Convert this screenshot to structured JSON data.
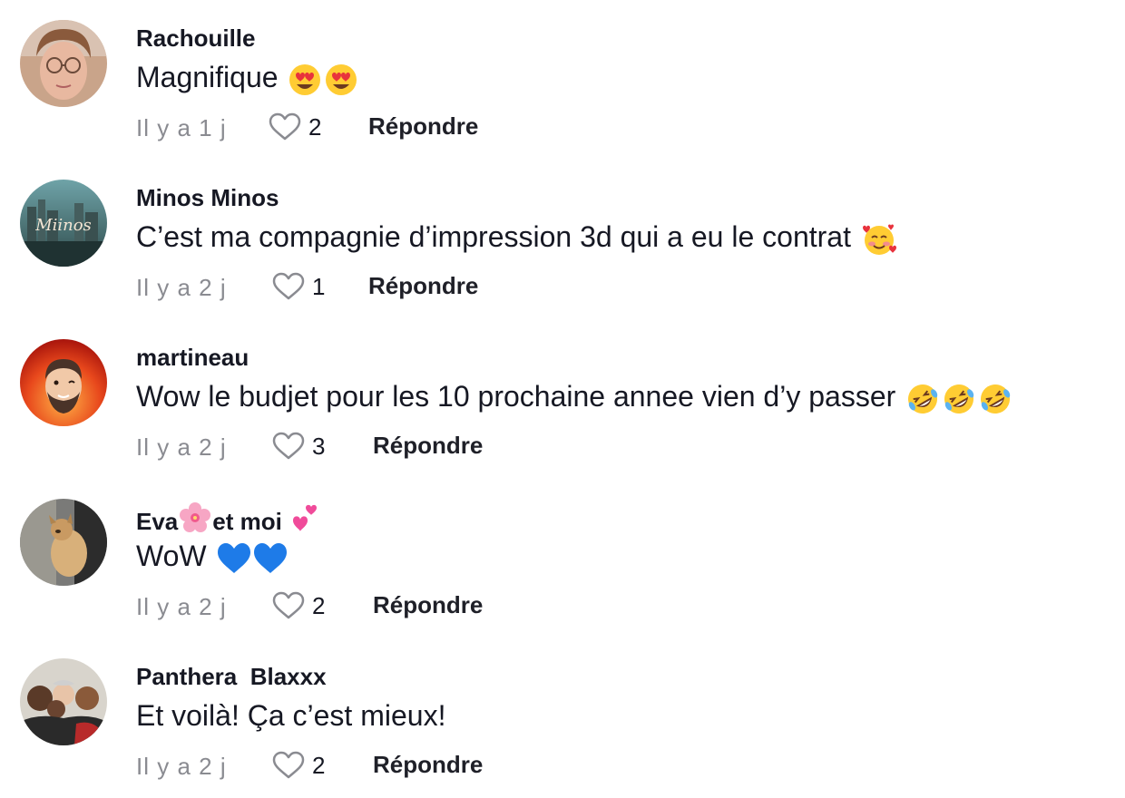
{
  "comments": [
    {
      "username": "Rachouille",
      "text": "Magnifique",
      "emojis": [
        "smiling-face-with-heart-eyes-emoji",
        "smiling-face-with-heart-eyes-emoji"
      ],
      "time": "Il y a 1 j",
      "likes": "2",
      "reply_label": "Répondre"
    },
    {
      "username": "Minos Minos",
      "text": "C’est ma compagnie d’impression 3d qui a eu le contrat",
      "emojis": [
        "smiling-face-with-hearts-emoji"
      ],
      "time": "Il y a 2 j",
      "likes": "1",
      "reply_label": "Répondre"
    },
    {
      "username": "martineau",
      "text": "Wow le budjet pour les 10 prochaine annee vien d’y passer",
      "emojis": [
        "rolling-on-the-floor-laughing-emoji",
        "rolling-on-the-floor-laughing-emoji",
        "rolling-on-the-floor-laughing-emoji"
      ],
      "time": "Il y a 2 j",
      "likes": "3",
      "reply_label": "Répondre"
    },
    {
      "username_part1": "Eva",
      "username_part2": "et moi",
      "username_emojis": [
        "cherry-blossom-emoji",
        "two-hearts-emoji"
      ],
      "text": "WoW",
      "emojis": [
        "blue-heart-emoji",
        "blue-heart-emoji"
      ],
      "time": "Il y a 2 j",
      "likes": "2",
      "reply_label": "Répondre"
    },
    {
      "username": "Panthera  Blaxxx",
      "text": "Et voilà! Ça c’est mieux!",
      "time": "Il y a 2 j",
      "likes": "2",
      "reply_label": "Répondre"
    }
  ],
  "avatar_logo_text": "Miinos",
  "colors": {
    "text_primary": "#161823",
    "text_secondary": "#8a8b91",
    "background": "#ffffff"
  }
}
